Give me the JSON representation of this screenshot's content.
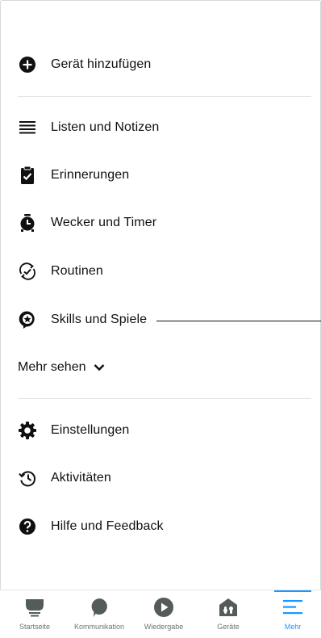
{
  "menu": {
    "add_device": "Gerät hinzufügen",
    "lists": "Listen und Notizen",
    "reminders": "Erinnerungen",
    "alarms": "Wecker und Timer",
    "routines": "Routinen",
    "skills": "Skills und Spiele",
    "see_more": "Mehr sehen",
    "settings": "Einstellungen",
    "activity": "Aktivitäten",
    "help": "Hilfe und Feedback"
  },
  "tabs": {
    "home": "Startseite",
    "communicate": "Kommunikation",
    "play": "Wiedergabe",
    "devices": "Geräte",
    "more": "Mehr"
  },
  "colors": {
    "accent": "#1a98ff",
    "text": "#0f1111",
    "tab_icon": "#545b5b"
  },
  "active_tab": "more"
}
